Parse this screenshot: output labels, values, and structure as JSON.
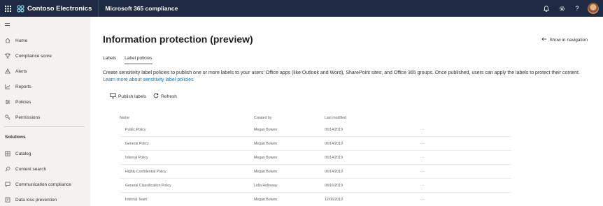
{
  "topbar": {
    "brand": "Contoso Electronics",
    "app_title": "Microsoft 365 compliance"
  },
  "sidebar": {
    "items": [
      {
        "label": "Home",
        "icon": "home-icon"
      },
      {
        "label": "Compliance score",
        "icon": "trophy-icon"
      },
      {
        "label": "Alerts",
        "icon": "warning-icon"
      },
      {
        "label": "Reports",
        "icon": "chart-icon"
      },
      {
        "label": "Policies",
        "icon": "policies-icon"
      },
      {
        "label": "Permissions",
        "icon": "key-icon"
      }
    ],
    "section_title": "Solutions",
    "solutions": [
      {
        "label": "Catalog",
        "icon": "catalog-icon"
      },
      {
        "label": "Content search",
        "icon": "search-icon"
      },
      {
        "label": "Communication compliance",
        "icon": "chat-icon"
      },
      {
        "label": "Data loss prevention",
        "icon": "shield-icon"
      }
    ]
  },
  "main": {
    "title": "Information protection (preview)",
    "show_nav": "Show in navigation",
    "tabs": [
      {
        "label": "Labels",
        "active": false
      },
      {
        "label": "Label policies",
        "active": true
      }
    ],
    "description": "Create sensitivity label policies to publish one or more labels to your users' Office apps (like Outlook and Word), SharePoint sites, and Office 365 groups. Once published, users can apply the labels to protect their content.",
    "learn_more": "Learn more about sensitivity label policies",
    "toolbar": {
      "publish": "Publish labels",
      "refresh": "Refresh"
    },
    "table": {
      "headers": [
        "Name",
        "Created by",
        "Last modified"
      ],
      "rows": [
        {
          "name": "Public Policy",
          "created_by": "Megan Bowen",
          "modified": "06/14/2019",
          "more": "···"
        },
        {
          "name": "General Policy",
          "created_by": "Megan Bowen",
          "modified": "06/14/2019",
          "more": "···"
        },
        {
          "name": "Internal Policy",
          "created_by": "Megan Bowen",
          "modified": "06/14/2019",
          "more": "···"
        },
        {
          "name": "Highly Confidential Policy",
          "created_by": "Megan Bowen",
          "modified": "06/14/2019",
          "more": "···"
        },
        {
          "name": "General Classification Policy",
          "created_by": "Lidia Holloway",
          "modified": "08/16/2019",
          "more": "···"
        },
        {
          "name": "Internal Team",
          "created_by": "Megan Bowen",
          "modified": "12/06/2019",
          "more": "···"
        }
      ]
    }
  },
  "colors": {
    "topbar": "#1f2a44",
    "accent": "#0078d4",
    "sidebar": "#f3f2f1"
  }
}
